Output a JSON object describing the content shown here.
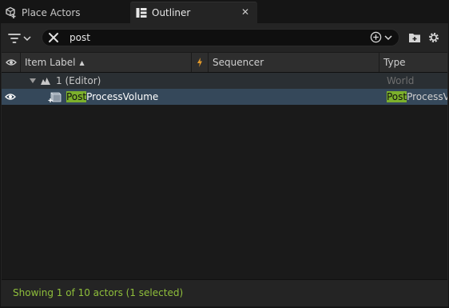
{
  "tabs": [
    {
      "label": "Place Actors",
      "icon": "place-actors-icon"
    },
    {
      "label": "Outliner",
      "icon": "outliner-icon"
    }
  ],
  "search": {
    "value": "post"
  },
  "columns": {
    "item_label": "Item Label",
    "sequencer": "Sequencer",
    "type": "Type"
  },
  "rows": [
    {
      "label": "1 (Editor)",
      "type": "World",
      "expanded": true
    },
    {
      "label_highlight": "Post",
      "label_rest": "ProcessVolume",
      "type_highlight": "Post",
      "type_rest": "ProcessVolume",
      "selected": true
    }
  ],
  "status_text": "Showing 1 of 10 actors (1 selected)",
  "colors": {
    "accent_green": "#7cb02c",
    "status_green": "#8fbf3b",
    "selection": "#35485a"
  }
}
